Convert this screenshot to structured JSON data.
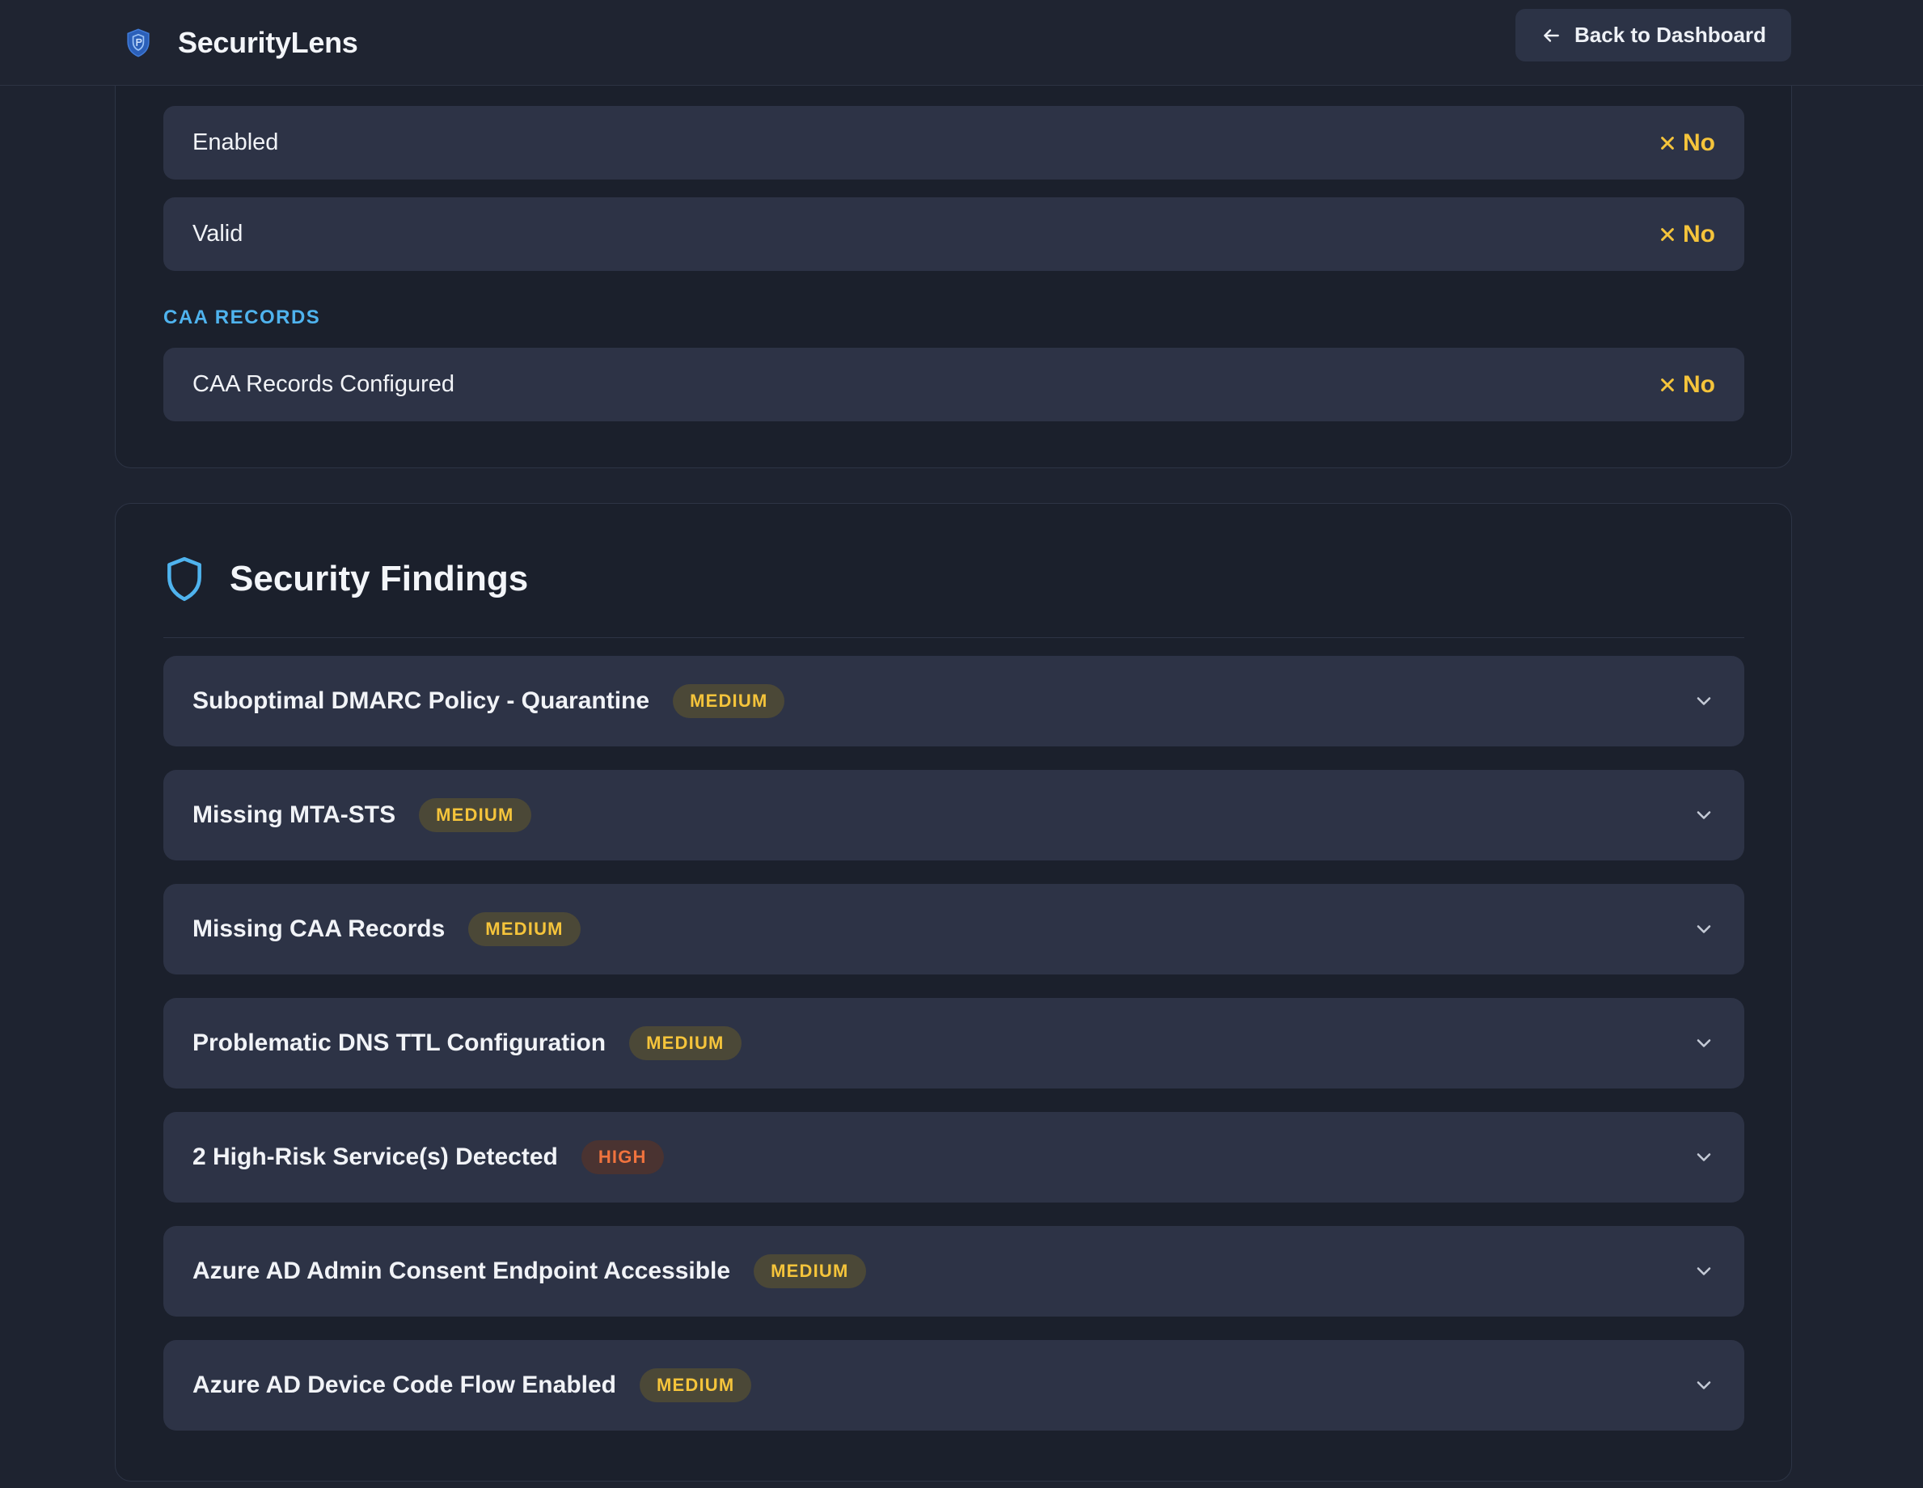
{
  "app": {
    "name": "SecurityLens",
    "back_button_label": "Back to Dashboard"
  },
  "colors": {
    "accent": "#4fb3ee",
    "warning": "#f5c43b",
    "high": "#f0733e",
    "background": "#1e2330",
    "row": "#2d3346"
  },
  "top_section": {
    "rows": [
      {
        "label": "Enabled",
        "status": "No",
        "icon": "x-icon"
      },
      {
        "label": "Valid",
        "status": "No",
        "icon": "x-icon"
      }
    ],
    "caa": {
      "heading": "CAA RECORDS",
      "rows": [
        {
          "label": "CAA Records Configured",
          "status": "No",
          "icon": "x-icon"
        }
      ]
    }
  },
  "findings": {
    "title": "Security Findings",
    "icon": "shield-icon",
    "items": [
      {
        "title": "Suboptimal DMARC Policy - Quarantine",
        "severity": "MEDIUM"
      },
      {
        "title": "Missing MTA-STS",
        "severity": "MEDIUM"
      },
      {
        "title": "Missing CAA Records",
        "severity": "MEDIUM"
      },
      {
        "title": "Problematic DNS TTL Configuration",
        "severity": "MEDIUM"
      },
      {
        "title": "2 High-Risk Service(s) Detected",
        "severity": "HIGH"
      },
      {
        "title": "Azure AD Admin Consent Endpoint Accessible",
        "severity": "MEDIUM"
      },
      {
        "title": "Azure AD Device Code Flow Enabled",
        "severity": "MEDIUM"
      }
    ]
  }
}
